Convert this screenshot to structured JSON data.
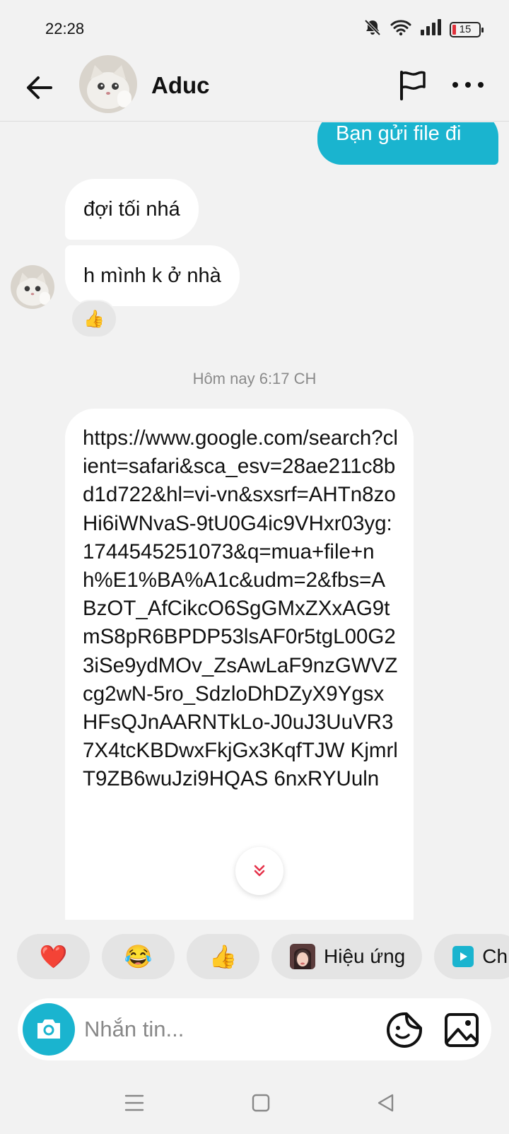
{
  "status_bar": {
    "time": "22:28",
    "battery_level": "15",
    "icons": [
      "mute-bell-icon",
      "wifi-icon",
      "signal-icon",
      "battery-low-icon"
    ]
  },
  "header": {
    "contact_name": "Aduc",
    "icons": [
      "back-arrow-icon",
      "flag-icon",
      "more-icon"
    ]
  },
  "messages": {
    "outgoing_1": "Bạn gửi file đi",
    "incoming_1": "đợi tối nhá",
    "incoming_2": "h mình k ở nhà",
    "reaction": "👍",
    "timestamp": "Hôm nay 6:17 CH",
    "link_message": "https://www.google.com/search?client=safari&sca_esv=28ae211c8bd1d722&hl=vi-vn&sxsrf=AHTn8zoHi6iWNvaS-9tU0G4ic9VHxr03yg:1744545251073&q=mua+file+nh%E1%BA%A1c&udm=2&fbs=ABzOT_AfCikcO6SgGMxZXxAG9tmS8pR6BPDP53lsAF0r5tgL00G23iSe9ydMOv_ZsAwLaF9nzGWVZcg2wN-5ro_SdzloDhDZyX9YgsxHFsQJnAARNTkLo-J0uJ3UuVR37X4tcKBDwxFkjGx3KqfTJW KjmrlT9ZB6wuJzi9HQAS 6nxRYUuln",
    "scroll_down_icon": "double-chevron-down-icon"
  },
  "quick_reactions": {
    "heart": "❤️",
    "laugh": "😂",
    "thumbs_up": "👍",
    "effect_label": "Hiệu ứng",
    "more_label": "Ch"
  },
  "input": {
    "placeholder": "Nhắn tin...",
    "value": ""
  },
  "colors": {
    "accent": "#1ab4cf",
    "background": "#f2f2f2",
    "bubble_incoming": "#ffffff",
    "chip_background": "#e4e4e4"
  }
}
